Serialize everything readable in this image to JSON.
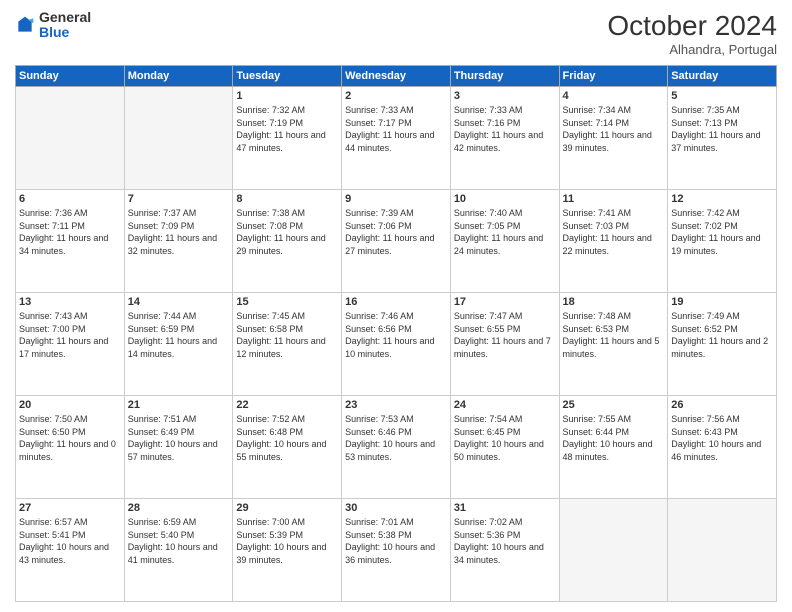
{
  "logo": {
    "general": "General",
    "blue": "Blue"
  },
  "header": {
    "month": "October 2024",
    "location": "Alhandra, Portugal"
  },
  "days_of_week": [
    "Sunday",
    "Monday",
    "Tuesday",
    "Wednesday",
    "Thursday",
    "Friday",
    "Saturday"
  ],
  "weeks": [
    [
      {
        "day": "",
        "empty": true
      },
      {
        "day": "",
        "empty": true
      },
      {
        "day": "1",
        "sunrise": "Sunrise: 7:32 AM",
        "sunset": "Sunset: 7:19 PM",
        "daylight": "Daylight: 11 hours and 47 minutes."
      },
      {
        "day": "2",
        "sunrise": "Sunrise: 7:33 AM",
        "sunset": "Sunset: 7:17 PM",
        "daylight": "Daylight: 11 hours and 44 minutes."
      },
      {
        "day": "3",
        "sunrise": "Sunrise: 7:33 AM",
        "sunset": "Sunset: 7:16 PM",
        "daylight": "Daylight: 11 hours and 42 minutes."
      },
      {
        "day": "4",
        "sunrise": "Sunrise: 7:34 AM",
        "sunset": "Sunset: 7:14 PM",
        "daylight": "Daylight: 11 hours and 39 minutes."
      },
      {
        "day": "5",
        "sunrise": "Sunrise: 7:35 AM",
        "sunset": "Sunset: 7:13 PM",
        "daylight": "Daylight: 11 hours and 37 minutes."
      }
    ],
    [
      {
        "day": "6",
        "sunrise": "Sunrise: 7:36 AM",
        "sunset": "Sunset: 7:11 PM",
        "daylight": "Daylight: 11 hours and 34 minutes."
      },
      {
        "day": "7",
        "sunrise": "Sunrise: 7:37 AM",
        "sunset": "Sunset: 7:09 PM",
        "daylight": "Daylight: 11 hours and 32 minutes."
      },
      {
        "day": "8",
        "sunrise": "Sunrise: 7:38 AM",
        "sunset": "Sunset: 7:08 PM",
        "daylight": "Daylight: 11 hours and 29 minutes."
      },
      {
        "day": "9",
        "sunrise": "Sunrise: 7:39 AM",
        "sunset": "Sunset: 7:06 PM",
        "daylight": "Daylight: 11 hours and 27 minutes."
      },
      {
        "day": "10",
        "sunrise": "Sunrise: 7:40 AM",
        "sunset": "Sunset: 7:05 PM",
        "daylight": "Daylight: 11 hours and 24 minutes."
      },
      {
        "day": "11",
        "sunrise": "Sunrise: 7:41 AM",
        "sunset": "Sunset: 7:03 PM",
        "daylight": "Daylight: 11 hours and 22 minutes."
      },
      {
        "day": "12",
        "sunrise": "Sunrise: 7:42 AM",
        "sunset": "Sunset: 7:02 PM",
        "daylight": "Daylight: 11 hours and 19 minutes."
      }
    ],
    [
      {
        "day": "13",
        "sunrise": "Sunrise: 7:43 AM",
        "sunset": "Sunset: 7:00 PM",
        "daylight": "Daylight: 11 hours and 17 minutes."
      },
      {
        "day": "14",
        "sunrise": "Sunrise: 7:44 AM",
        "sunset": "Sunset: 6:59 PM",
        "daylight": "Daylight: 11 hours and 14 minutes."
      },
      {
        "day": "15",
        "sunrise": "Sunrise: 7:45 AM",
        "sunset": "Sunset: 6:58 PM",
        "daylight": "Daylight: 11 hours and 12 minutes."
      },
      {
        "day": "16",
        "sunrise": "Sunrise: 7:46 AM",
        "sunset": "Sunset: 6:56 PM",
        "daylight": "Daylight: 11 hours and 10 minutes."
      },
      {
        "day": "17",
        "sunrise": "Sunrise: 7:47 AM",
        "sunset": "Sunset: 6:55 PM",
        "daylight": "Daylight: 11 hours and 7 minutes."
      },
      {
        "day": "18",
        "sunrise": "Sunrise: 7:48 AM",
        "sunset": "Sunset: 6:53 PM",
        "daylight": "Daylight: 11 hours and 5 minutes."
      },
      {
        "day": "19",
        "sunrise": "Sunrise: 7:49 AM",
        "sunset": "Sunset: 6:52 PM",
        "daylight": "Daylight: 11 hours and 2 minutes."
      }
    ],
    [
      {
        "day": "20",
        "sunrise": "Sunrise: 7:50 AM",
        "sunset": "Sunset: 6:50 PM",
        "daylight": "Daylight: 11 hours and 0 minutes."
      },
      {
        "day": "21",
        "sunrise": "Sunrise: 7:51 AM",
        "sunset": "Sunset: 6:49 PM",
        "daylight": "Daylight: 10 hours and 57 minutes."
      },
      {
        "day": "22",
        "sunrise": "Sunrise: 7:52 AM",
        "sunset": "Sunset: 6:48 PM",
        "daylight": "Daylight: 10 hours and 55 minutes."
      },
      {
        "day": "23",
        "sunrise": "Sunrise: 7:53 AM",
        "sunset": "Sunset: 6:46 PM",
        "daylight": "Daylight: 10 hours and 53 minutes."
      },
      {
        "day": "24",
        "sunrise": "Sunrise: 7:54 AM",
        "sunset": "Sunset: 6:45 PM",
        "daylight": "Daylight: 10 hours and 50 minutes."
      },
      {
        "day": "25",
        "sunrise": "Sunrise: 7:55 AM",
        "sunset": "Sunset: 6:44 PM",
        "daylight": "Daylight: 10 hours and 48 minutes."
      },
      {
        "day": "26",
        "sunrise": "Sunrise: 7:56 AM",
        "sunset": "Sunset: 6:43 PM",
        "daylight": "Daylight: 10 hours and 46 minutes."
      }
    ],
    [
      {
        "day": "27",
        "sunrise": "Sunrise: 6:57 AM",
        "sunset": "Sunset: 5:41 PM",
        "daylight": "Daylight: 10 hours and 43 minutes."
      },
      {
        "day": "28",
        "sunrise": "Sunrise: 6:59 AM",
        "sunset": "Sunset: 5:40 PM",
        "daylight": "Daylight: 10 hours and 41 minutes."
      },
      {
        "day": "29",
        "sunrise": "Sunrise: 7:00 AM",
        "sunset": "Sunset: 5:39 PM",
        "daylight": "Daylight: 10 hours and 39 minutes."
      },
      {
        "day": "30",
        "sunrise": "Sunrise: 7:01 AM",
        "sunset": "Sunset: 5:38 PM",
        "daylight": "Daylight: 10 hours and 36 minutes."
      },
      {
        "day": "31",
        "sunrise": "Sunrise: 7:02 AM",
        "sunset": "Sunset: 5:36 PM",
        "daylight": "Daylight: 10 hours and 34 minutes."
      },
      {
        "day": "",
        "empty": true
      },
      {
        "day": "",
        "empty": true
      }
    ]
  ]
}
